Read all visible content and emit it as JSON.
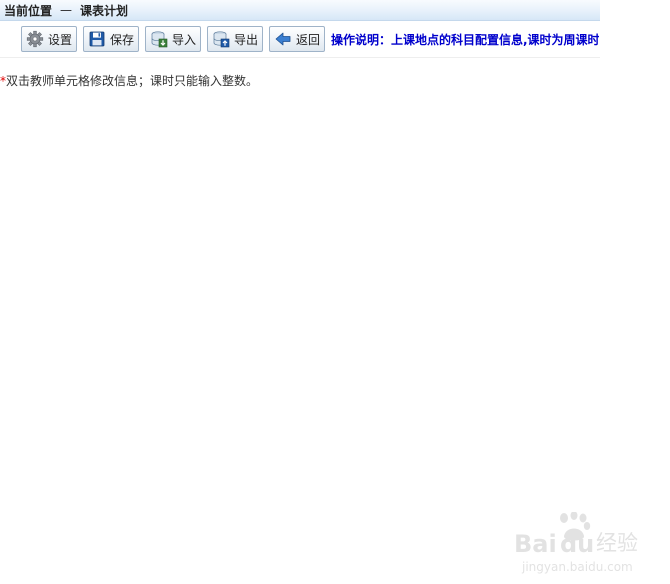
{
  "breadcrumb": {
    "location_label": "当前位置",
    "separator": "—",
    "current_page": "课表计划"
  },
  "toolbar": {
    "buttons": [
      {
        "label": "设置",
        "icon": "gear-icon"
      },
      {
        "label": "保存",
        "icon": "save-disk-icon"
      },
      {
        "label": "导入",
        "icon": "import-icon"
      },
      {
        "label": "导出",
        "icon": "export-icon"
      },
      {
        "label": "返回",
        "icon": "back-arrow-icon"
      }
    ],
    "instructions": "操作说明：上课地点的科目配置信息,课时为周课时"
  },
  "notice": {
    "asterisk": "*",
    "text": "双击教师单元格修改信息；课时只能输入整数。"
  },
  "watermark": {
    "logo_text": "Baidu经验",
    "url": "jingyan.baidu.com"
  },
  "colors": {
    "instructions_text": "#0000cc",
    "asterisk": "#e00000",
    "breadcrumb_bg": "#e7f1fb",
    "button_border": "#9fb3c8"
  }
}
